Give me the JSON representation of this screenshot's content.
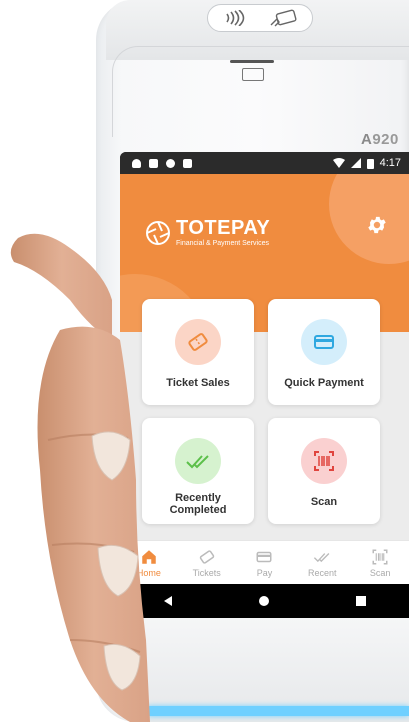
{
  "device": {
    "model_prefix": "A",
    "model_number": "920"
  },
  "status_bar": {
    "time": "4:17"
  },
  "app": {
    "brand_name": "TOTEPAY",
    "brand_tagline": "Financial & Payment Services",
    "accent_color": "#f08c3f"
  },
  "tiles": [
    {
      "label": "Ticket Sales",
      "icon": "ticket-icon",
      "bg": "#fbd5c6",
      "fg": "#f08c3f"
    },
    {
      "label": "Quick Payment",
      "icon": "card-icon",
      "bg": "#d4eefb",
      "fg": "#2fa8e0"
    },
    {
      "label": "Recently Completed",
      "icon": "double-check-icon",
      "bg": "#d6f2cf",
      "fg": "#5cc04a"
    },
    {
      "label": "Scan",
      "icon": "barcode-scan-icon",
      "bg": "#fad0d0",
      "fg": "#e0443e"
    }
  ],
  "tabs": [
    {
      "label": "Home",
      "icon": "home-icon",
      "active": true
    },
    {
      "label": "Tickets",
      "icon": "ticket-icon",
      "active": false
    },
    {
      "label": "Pay",
      "icon": "card-icon",
      "active": false
    },
    {
      "label": "Recent",
      "icon": "double-check-icon",
      "active": false
    },
    {
      "label": "Scan",
      "icon": "barcode-scan-icon",
      "active": false
    }
  ]
}
